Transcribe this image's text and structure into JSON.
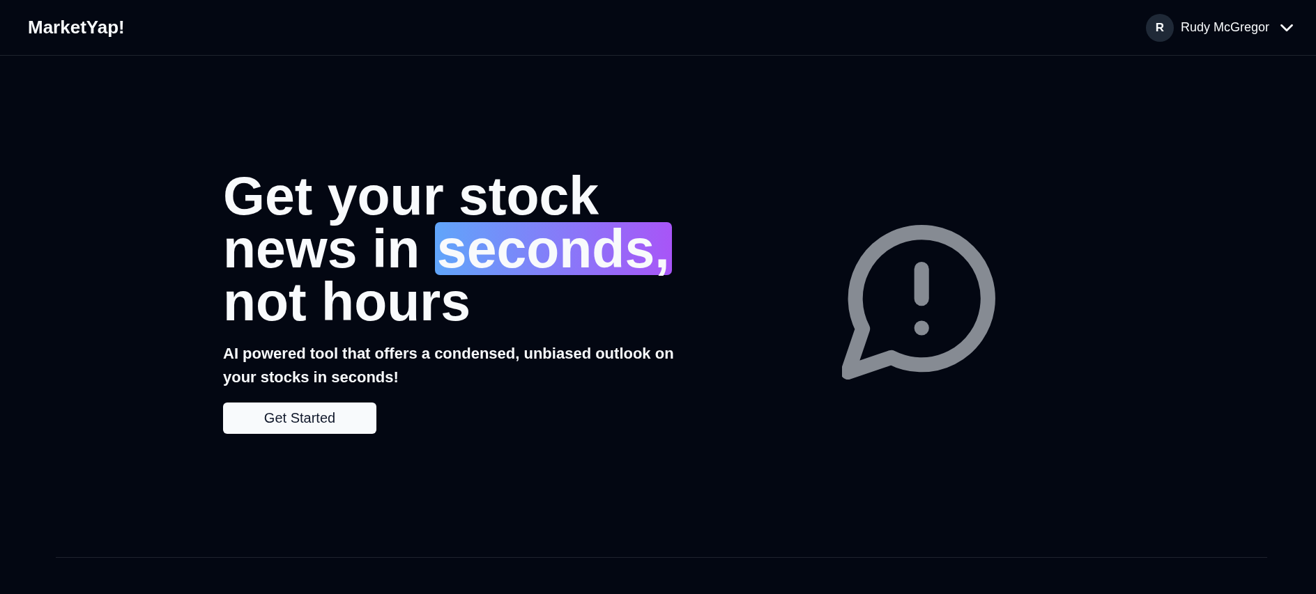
{
  "header": {
    "logo": "MarketYap!",
    "user": {
      "initial": "R",
      "name": "Rudy McGregor"
    }
  },
  "hero": {
    "headline": [
      {
        "text": "Get your stock news in",
        "highlighted": false
      },
      {
        "text": "seconds,",
        "highlighted": true
      },
      {
        "text": "not hours",
        "highlighted": false
      }
    ],
    "subtitle": "AI powered tool that offers a condensed, unbiased outlook on your stocks in seconds!",
    "button": "Get Started"
  }
}
